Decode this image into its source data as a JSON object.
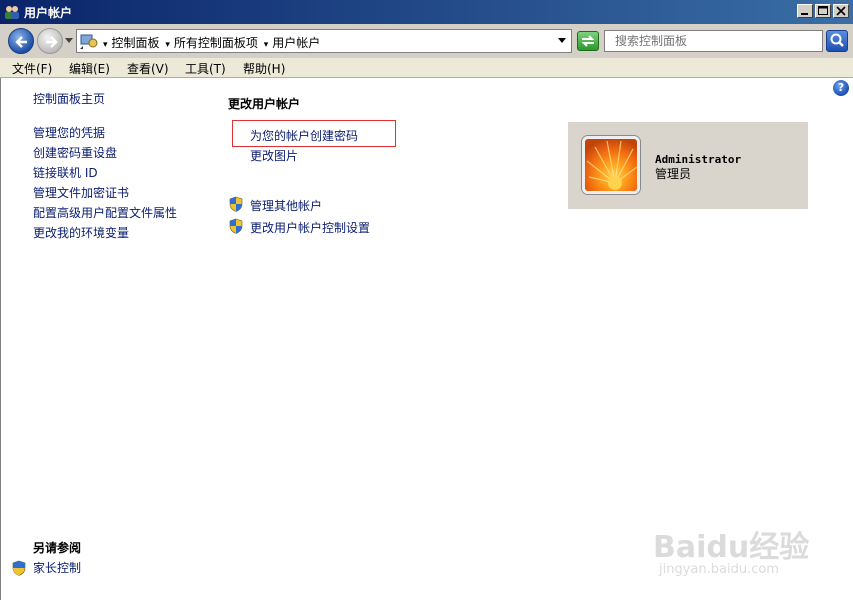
{
  "window": {
    "title": "用户帐户"
  },
  "address": {
    "breadcrumbs": [
      "控制面板",
      "所有控制面板项",
      "用户帐户"
    ],
    "search_placeholder": "搜索控制面板"
  },
  "menu": [
    "文件(F)",
    "编辑(E)",
    "查看(V)",
    "工具(T)",
    "帮助(H)"
  ],
  "sidebar": {
    "home": "控制面板主页",
    "links": [
      "管理您的凭据",
      "创建密码重设盘",
      "链接联机 ID",
      "管理文件加密证书",
      "配置高级用户配置文件属性",
      "更改我的环境变量"
    ],
    "see_also_title": "另请参阅",
    "see_also": [
      "家长控制"
    ]
  },
  "main": {
    "title": "更改用户帐户",
    "tasks": [
      "为您的帐户创建密码",
      "更改图片"
    ],
    "admin_tasks": [
      "管理其他帐户",
      "更改用户帐户控制设置"
    ]
  },
  "user": {
    "name": "Administrator",
    "role": "管理员"
  },
  "watermark": {
    "logo": "Baidu经验",
    "url": "jingyan.baidu.com"
  },
  "colors": {
    "link": "#0a1d6e",
    "highlight_box": "#e03030",
    "titlebar": "#0a246a"
  }
}
